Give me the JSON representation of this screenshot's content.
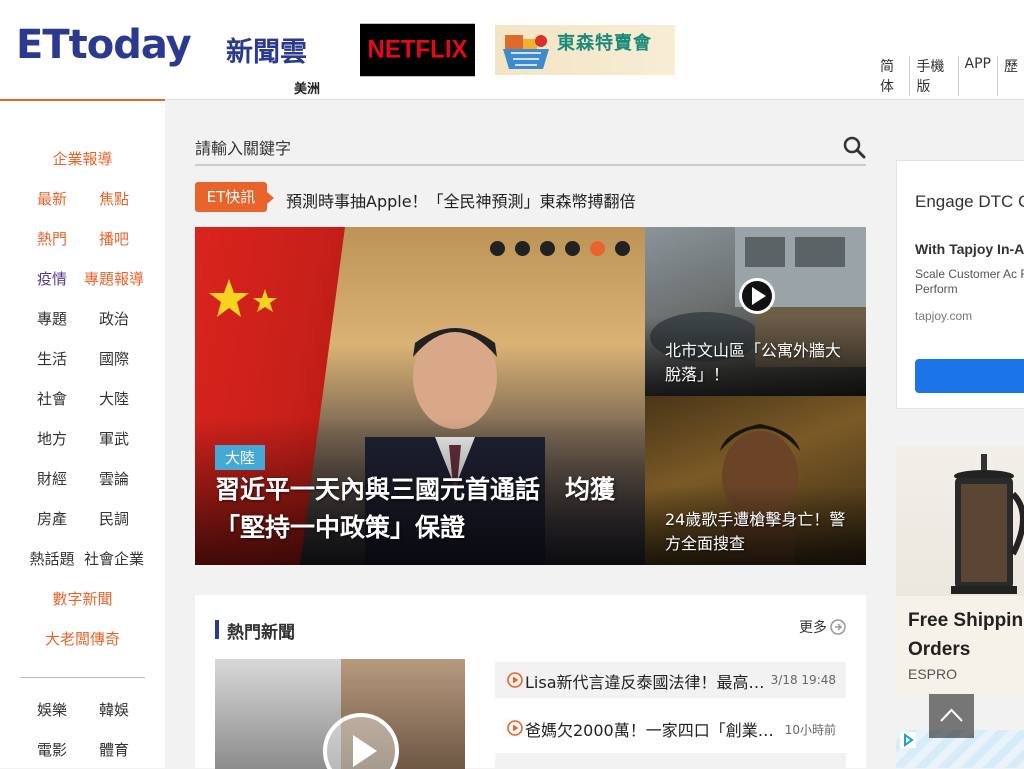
{
  "header": {
    "logo_text": "ETtoday",
    "logo_cn": "新聞雲",
    "region": "美洲",
    "netflix_label": "NETFLIX",
    "promo_label": "東森特賣會",
    "topnav": [
      "简体",
      "手機版",
      "APP",
      "歷"
    ]
  },
  "leftnav": {
    "enterprise": "企業報導",
    "rows": [
      {
        "l": "最新",
        "r": "焦點"
      },
      {
        "l": "熱門",
        "r": "播吧"
      },
      {
        "l": "疫情",
        "r": "專題報導"
      },
      {
        "l": "專題",
        "r": "政治"
      },
      {
        "l": "生活",
        "r": "國際"
      },
      {
        "l": "社會",
        "r": "大陸"
      },
      {
        "l": "地方",
        "r": "軍武"
      },
      {
        "l": "財經",
        "r": "雲論"
      },
      {
        "l": "房產",
        "r": "民調"
      },
      {
        "l": "熱話題",
        "r": "社會企業"
      }
    ],
    "digital": "數字新聞",
    "boss": "大老闆傳奇",
    "rows2": [
      {
        "l": "娛樂",
        "r": "韓娛"
      },
      {
        "l": "電影",
        "r": "體育"
      }
    ]
  },
  "search": {
    "placeholder": "請輸入關鍵字"
  },
  "flash": {
    "badge": "ET快訊",
    "text": "預測時事抽Apple！「全民神預測」東森幣搏翻倍"
  },
  "hero": {
    "tag": "大陸",
    "title": "習近平一天內與三國元首通話　均獲「堅持一中政策」保證",
    "slide_count": 6,
    "active_slide": 5
  },
  "side_cards": [
    {
      "title": "北市文山區「公寓外牆大脫落」！"
    },
    {
      "title": "24歲歌手遭槍擊身亡！警方全面搜查"
    }
  ],
  "hot": {
    "title": "熱門新聞",
    "more": "更多",
    "items": [
      {
        "text": "Lisa新代言違反泰國法律！最高「…",
        "time": "3/18 19:48"
      },
      {
        "text": "爸媽欠2000萬！一家四口「創業責…",
        "time": "10小時前"
      }
    ]
  },
  "ads": {
    "ad1": {
      "heading": "Engage DTC Convert",
      "sub": "With Tapjoy In-A",
      "desc": "Scale Customer Ac ROAS With Perform",
      "url": "tapjoy.com"
    },
    "ad2": {
      "heading": "Free Shippin U.S. Orders",
      "brand": "ESPRO"
    }
  },
  "colors": {
    "accent": "#e8642c",
    "brand_blue": "#2b3a8f",
    "tag_blue": "#45a9d6"
  }
}
